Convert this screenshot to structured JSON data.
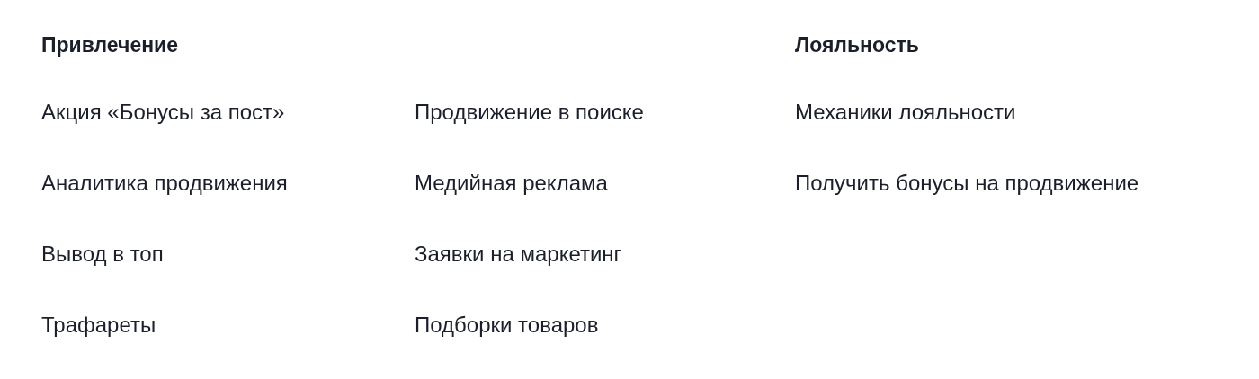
{
  "sections": [
    {
      "title": "Привлечение",
      "columns": [
        [
          "Акция «Бонусы за пост»",
          "Аналитика продвижения",
          "Вывод в топ",
          "Трафареты"
        ],
        [
          "Продвижение в поиске",
          "Медийная реклама",
          "Заявки на маркетинг",
          "Подборки товаров"
        ]
      ]
    },
    {
      "title": "Лояльность",
      "columns": [
        [
          "Механики лояльности",
          "Получить бонусы на продвижение"
        ]
      ]
    }
  ]
}
